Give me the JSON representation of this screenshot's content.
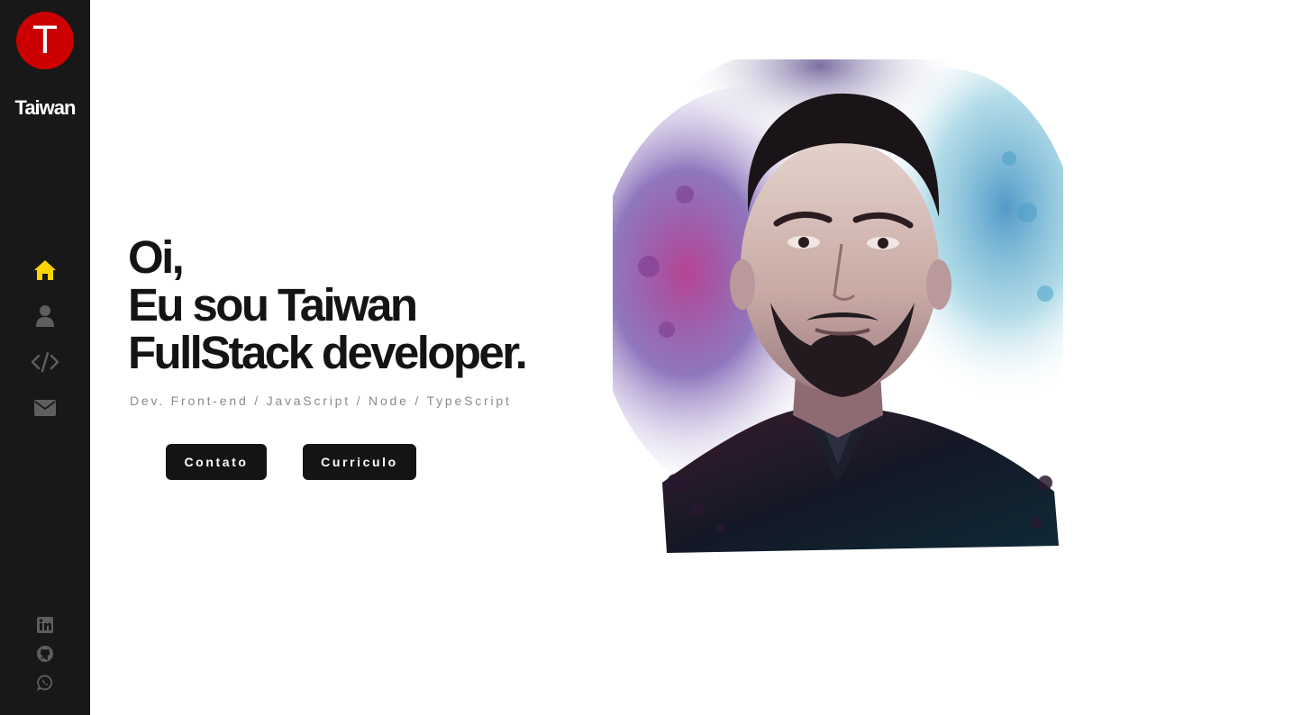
{
  "sidebar": {
    "logo_letter": "T",
    "logo_name": "Taiwan",
    "nav": [
      {
        "icon": "home-icon",
        "active": true
      },
      {
        "icon": "user-icon",
        "active": false
      },
      {
        "icon": "code-icon",
        "active": false
      },
      {
        "icon": "envelope-icon",
        "active": false
      }
    ],
    "social": [
      {
        "icon": "linkedin-icon"
      },
      {
        "icon": "github-icon"
      },
      {
        "icon": "whatsapp-icon"
      }
    ]
  },
  "hero": {
    "line1": "Oi,",
    "line2": "Eu sou Taiwan",
    "line3": "FullStack developer.",
    "subtitle": "Dev. Front-end / JavaScript / Node / TypeScript",
    "contact_button": "Contato",
    "resume_button": "Curriculo"
  },
  "colors": {
    "sidebar_bg": "#181818",
    "logo_bg": "#cc0000",
    "active_icon": "#ffd400",
    "inactive_icon": "#5e5e5e",
    "button_bg": "#141414"
  }
}
